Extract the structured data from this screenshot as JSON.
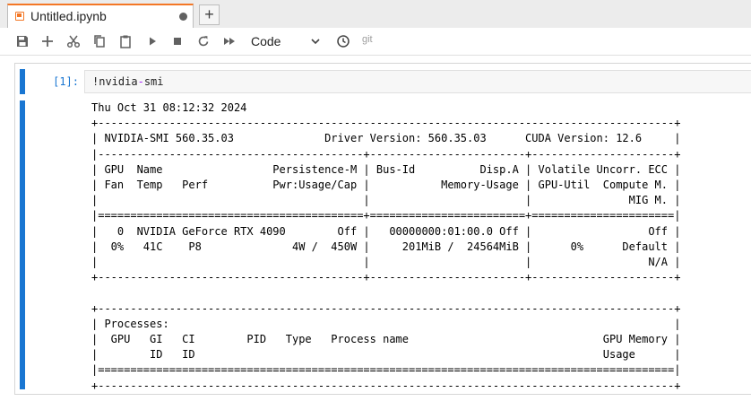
{
  "tab": {
    "title": "Untitled.ipynb",
    "new_tab_symbol": "+"
  },
  "toolbar": {
    "buttons": [
      "save-icon",
      "add-cell-icon",
      "cut-icon",
      "copy-icon",
      "paste-icon",
      "run-icon",
      "stop-icon",
      "restart-icon",
      "run-all-icon"
    ],
    "cell_type": "Code",
    "git_label": "git"
  },
  "cell": {
    "prompt": "[1]:",
    "code_prefix": "!nvidia",
    "code_op": "-",
    "code_suffix": "smi"
  },
  "output": {
    "lines": [
      "Thu Oct 31 08:12:32 2024",
      "+-----------------------------------------------------------------------------------------+",
      "| NVIDIA-SMI 560.35.03              Driver Version: 560.35.03      CUDA Version: 12.6     |",
      "|-----------------------------------------+------------------------+----------------------+",
      "| GPU  Name                 Persistence-M | Bus-Id          Disp.A | Volatile Uncorr. ECC |",
      "| Fan  Temp   Perf          Pwr:Usage/Cap |           Memory-Usage | GPU-Util  Compute M. |",
      "|                                         |                        |               MIG M. |",
      "|=========================================+========================+======================|",
      "|   0  NVIDIA GeForce RTX 4090        Off |   00000000:01:00.0 Off |                  Off |",
      "|  0%   41C    P8              4W /  450W |     201MiB /  24564MiB |      0%      Default |",
      "|                                         |                        |                  N/A |",
      "+-----------------------------------------+------------------------+----------------------+",
      "",
      "+-----------------------------------------------------------------------------------------+",
      "| Processes:                                                                              |",
      "|  GPU   GI   CI        PID   Type   Process name                              GPU Memory |",
      "|        ID   ID                                                               Usage      |",
      "|=========================================================================================|",
      "+-----------------------------------------------------------------------------------------+"
    ]
  },
  "colors": {
    "accent": "#1976d2",
    "tab_accent": "#f37726",
    "operator": "#aa22ff"
  }
}
